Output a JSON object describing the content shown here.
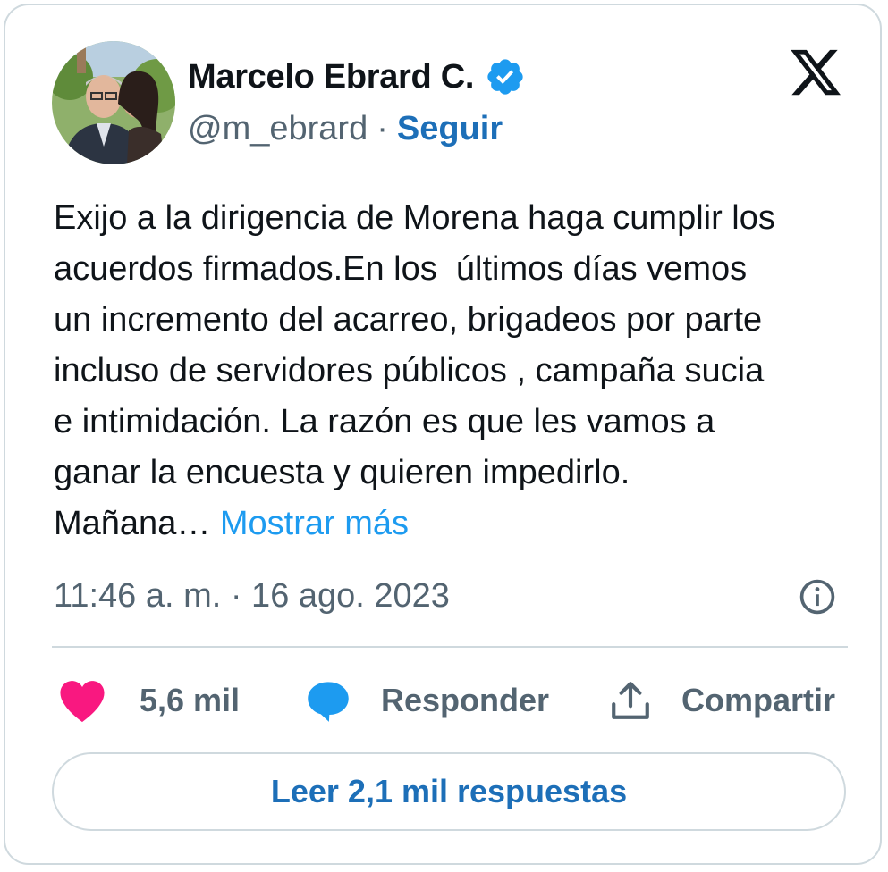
{
  "author": {
    "display_name": "Marcelo Ebrard C.",
    "handle": "@m_ebrard",
    "separator": "·",
    "follow_label": "Seguir",
    "verified": true
  },
  "tweet": {
    "lines": [
      "Exijo a la dirigencia de Morena haga cumplir los",
      "acuerdos firmados.En los  últimos días vemos",
      "un incremento del acarreo, brigadeos por parte",
      "incluso de servidores públicos , campaña sucia",
      "e intimidación. La razón es que les vamos a",
      "ganar la encuesta y quieren impedirlo.",
      "Mañana…"
    ],
    "show_more_label": "Mostrar más",
    "timestamp": "11:46 a. m. · 16 ago. 2023"
  },
  "actions": {
    "likes_label": "5,6 mil",
    "reply_label": "Responder",
    "share_label": "Compartir"
  },
  "read_replies_label": "Leer 2,1 mil respuestas",
  "icons": {
    "verified": "verified-badge-icon",
    "logo": "x-logo-icon",
    "info": "info-icon",
    "like": "heart-icon",
    "reply": "speech-bubble-icon",
    "share": "upload-icon"
  },
  "colors": {
    "link": "#1d9bf0",
    "follow": "#1d6fb8",
    "like": "#f91880",
    "reply": "#1d9bf0",
    "muted": "#536471",
    "border": "#cfd9de",
    "text": "#0f1419"
  }
}
